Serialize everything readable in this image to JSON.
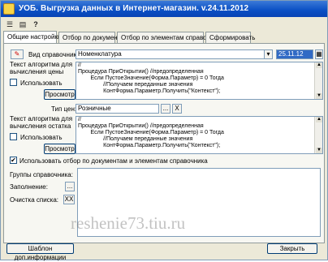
{
  "window": {
    "title": "УОБ. Выгрузка данных в Интернет-магазин. v.24.11.2012"
  },
  "toolbar": {
    "icons": [
      "list-icon",
      "save-icon",
      "help-icon"
    ],
    "help_label": "?"
  },
  "tabs": [
    {
      "label": "Общие настройки",
      "active": true
    },
    {
      "label": "Отбор по документам"
    },
    {
      "label": "Отбор по элементам справочника"
    },
    {
      "label": "Сформировать"
    }
  ],
  "catalog": {
    "label": "Вид справочника:",
    "value": "Номенклатура",
    "date": "25.11.12"
  },
  "price_algo": {
    "label_line1": "Текст алгоритма для",
    "label_line2": "вычисления цены",
    "use_label": "Использовать",
    "view_button": "Просмотр",
    "code": [
      "//",
      "Процедура ПриОткрытии() //предопределенная",
      "        Если ПустоеЗначение(Форма.Параметр) = 0 Тогда",
      "                //Получаем переданные значения",
      "                КонтФорма.Параметр.Получить(\"Контекст\");"
    ]
  },
  "price_type": {
    "label": "Тип цен:",
    "value": "Розничные",
    "select_btn": "...",
    "clear_btn": "X"
  },
  "stock_algo": {
    "label_line1": "Текст алгоритма для",
    "label_line2": "вычисления остатка",
    "use_label": "Использовать",
    "view_button": "Просмотр",
    "code": [
      "//",
      "Процедура ПриОткрытии() //предопределенная",
      "        Если ПустоеЗначение(Форма.Параметр) = 0 Тогда",
      "                //Получаем переданные значения",
      "                КонтФорма.Параметр.Получить(\"Контекст\");"
    ]
  },
  "filter_option": {
    "label": "Использовать отбор по документам и элементам справочника",
    "checked": true
  },
  "groups": {
    "label": "Группы справочника:",
    "fill_label": "Заполнение:",
    "fill_btn": "...",
    "clear_label": "Очистка списка:",
    "clear_btn": "XX"
  },
  "footer": {
    "template_button": "Шаблон доп.информации",
    "close_button": "Закрыть"
  },
  "watermark": "reshenie73.tiu.ru"
}
